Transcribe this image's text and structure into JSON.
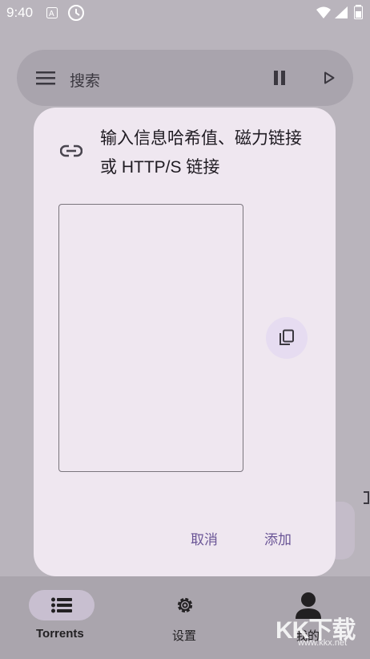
{
  "status_bar": {
    "time": "9:40",
    "icons": [
      "a-letter-icon",
      "clock-badge-icon",
      "wifi-icon",
      "signal-icon",
      "battery-icon"
    ]
  },
  "search_bar": {
    "placeholder": "搜索",
    "icons": [
      "menu-icon",
      "pause-icon",
      "play-icon"
    ]
  },
  "dialog": {
    "title": "输入信息哈希值、磁力链接或 HTTP/S 链接",
    "input_value": "",
    "cancel_label": "取消",
    "add_label": "添加",
    "icons": [
      "link-icon",
      "paste-icon"
    ]
  },
  "bottom_nav": {
    "items": [
      {
        "label": "Torrents",
        "icon": "list-icon",
        "active": true
      },
      {
        "label": "设置",
        "icon": "gear-icon",
        "active": false
      },
      {
        "label": "我的",
        "icon": "person-icon",
        "active": false
      }
    ]
  },
  "watermark": {
    "text": "KK下载",
    "url": "www.kkx.net"
  },
  "colors": {
    "accent": "#6a5596",
    "dialog_bg": "#efe7f0",
    "scrim_bg": "#b9b4bc",
    "paste_button_bg": "#e6dcf1"
  }
}
